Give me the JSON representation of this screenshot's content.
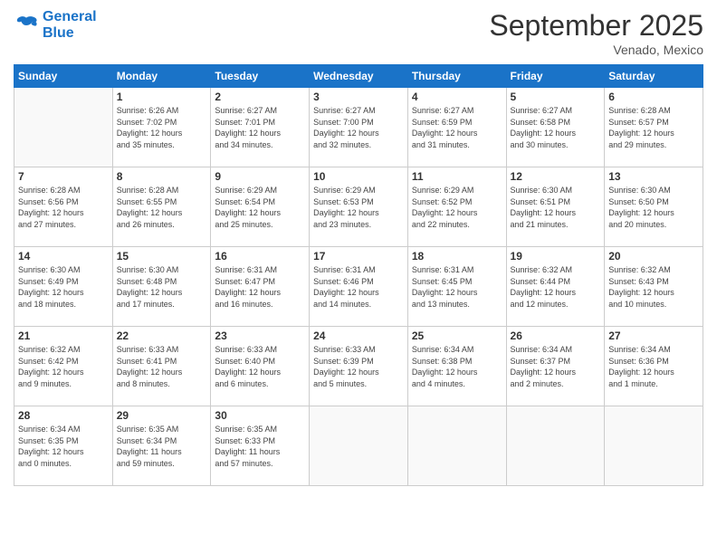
{
  "logo": {
    "line1": "General",
    "line2": "Blue"
  },
  "title": "September 2025",
  "location": "Venado, Mexico",
  "days_of_week": [
    "Sunday",
    "Monday",
    "Tuesday",
    "Wednesday",
    "Thursday",
    "Friday",
    "Saturday"
  ],
  "weeks": [
    [
      {
        "day": "",
        "info": ""
      },
      {
        "day": "1",
        "info": "Sunrise: 6:26 AM\nSunset: 7:02 PM\nDaylight: 12 hours\nand 35 minutes."
      },
      {
        "day": "2",
        "info": "Sunrise: 6:27 AM\nSunset: 7:01 PM\nDaylight: 12 hours\nand 34 minutes."
      },
      {
        "day": "3",
        "info": "Sunrise: 6:27 AM\nSunset: 7:00 PM\nDaylight: 12 hours\nand 32 minutes."
      },
      {
        "day": "4",
        "info": "Sunrise: 6:27 AM\nSunset: 6:59 PM\nDaylight: 12 hours\nand 31 minutes."
      },
      {
        "day": "5",
        "info": "Sunrise: 6:27 AM\nSunset: 6:58 PM\nDaylight: 12 hours\nand 30 minutes."
      },
      {
        "day": "6",
        "info": "Sunrise: 6:28 AM\nSunset: 6:57 PM\nDaylight: 12 hours\nand 29 minutes."
      }
    ],
    [
      {
        "day": "7",
        "info": "Sunrise: 6:28 AM\nSunset: 6:56 PM\nDaylight: 12 hours\nand 27 minutes."
      },
      {
        "day": "8",
        "info": "Sunrise: 6:28 AM\nSunset: 6:55 PM\nDaylight: 12 hours\nand 26 minutes."
      },
      {
        "day": "9",
        "info": "Sunrise: 6:29 AM\nSunset: 6:54 PM\nDaylight: 12 hours\nand 25 minutes."
      },
      {
        "day": "10",
        "info": "Sunrise: 6:29 AM\nSunset: 6:53 PM\nDaylight: 12 hours\nand 23 minutes."
      },
      {
        "day": "11",
        "info": "Sunrise: 6:29 AM\nSunset: 6:52 PM\nDaylight: 12 hours\nand 22 minutes."
      },
      {
        "day": "12",
        "info": "Sunrise: 6:30 AM\nSunset: 6:51 PM\nDaylight: 12 hours\nand 21 minutes."
      },
      {
        "day": "13",
        "info": "Sunrise: 6:30 AM\nSunset: 6:50 PM\nDaylight: 12 hours\nand 20 minutes."
      }
    ],
    [
      {
        "day": "14",
        "info": "Sunrise: 6:30 AM\nSunset: 6:49 PM\nDaylight: 12 hours\nand 18 minutes."
      },
      {
        "day": "15",
        "info": "Sunrise: 6:30 AM\nSunset: 6:48 PM\nDaylight: 12 hours\nand 17 minutes."
      },
      {
        "day": "16",
        "info": "Sunrise: 6:31 AM\nSunset: 6:47 PM\nDaylight: 12 hours\nand 16 minutes."
      },
      {
        "day": "17",
        "info": "Sunrise: 6:31 AM\nSunset: 6:46 PM\nDaylight: 12 hours\nand 14 minutes."
      },
      {
        "day": "18",
        "info": "Sunrise: 6:31 AM\nSunset: 6:45 PM\nDaylight: 12 hours\nand 13 minutes."
      },
      {
        "day": "19",
        "info": "Sunrise: 6:32 AM\nSunset: 6:44 PM\nDaylight: 12 hours\nand 12 minutes."
      },
      {
        "day": "20",
        "info": "Sunrise: 6:32 AM\nSunset: 6:43 PM\nDaylight: 12 hours\nand 10 minutes."
      }
    ],
    [
      {
        "day": "21",
        "info": "Sunrise: 6:32 AM\nSunset: 6:42 PM\nDaylight: 12 hours\nand 9 minutes."
      },
      {
        "day": "22",
        "info": "Sunrise: 6:33 AM\nSunset: 6:41 PM\nDaylight: 12 hours\nand 8 minutes."
      },
      {
        "day": "23",
        "info": "Sunrise: 6:33 AM\nSunset: 6:40 PM\nDaylight: 12 hours\nand 6 minutes."
      },
      {
        "day": "24",
        "info": "Sunrise: 6:33 AM\nSunset: 6:39 PM\nDaylight: 12 hours\nand 5 minutes."
      },
      {
        "day": "25",
        "info": "Sunrise: 6:34 AM\nSunset: 6:38 PM\nDaylight: 12 hours\nand 4 minutes."
      },
      {
        "day": "26",
        "info": "Sunrise: 6:34 AM\nSunset: 6:37 PM\nDaylight: 12 hours\nand 2 minutes."
      },
      {
        "day": "27",
        "info": "Sunrise: 6:34 AM\nSunset: 6:36 PM\nDaylight: 12 hours\nand 1 minute."
      }
    ],
    [
      {
        "day": "28",
        "info": "Sunrise: 6:34 AM\nSunset: 6:35 PM\nDaylight: 12 hours\nand 0 minutes."
      },
      {
        "day": "29",
        "info": "Sunrise: 6:35 AM\nSunset: 6:34 PM\nDaylight: 11 hours\nand 59 minutes."
      },
      {
        "day": "30",
        "info": "Sunrise: 6:35 AM\nSunset: 6:33 PM\nDaylight: 11 hours\nand 57 minutes."
      },
      {
        "day": "",
        "info": ""
      },
      {
        "day": "",
        "info": ""
      },
      {
        "day": "",
        "info": ""
      },
      {
        "day": "",
        "info": ""
      }
    ]
  ]
}
